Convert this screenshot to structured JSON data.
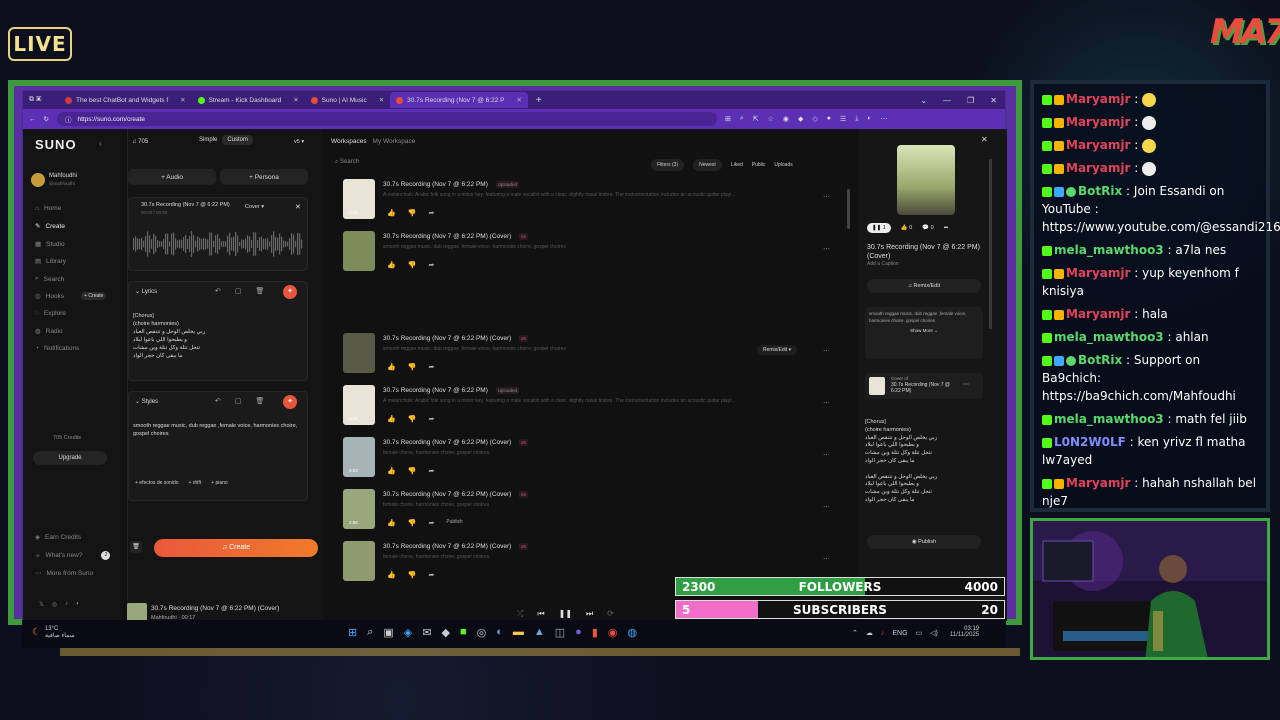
{
  "overlay": {
    "live": "LIVE",
    "logo": "MA7"
  },
  "browser": {
    "tabs": [
      {
        "label": "The best ChatBot and Widgets f",
        "color": "#d23c3c"
      },
      {
        "label": "Stream - Kick Dashboard",
        "color": "#53fc18"
      },
      {
        "label": "Suno | AI Music",
        "color": "#e74c3c"
      },
      {
        "label": "30.7s Recording (Nov 7 @ 6:22 P",
        "color": "#e74c3c"
      }
    ],
    "new_tab": "+",
    "url": "https://suno.com/create"
  },
  "suno": {
    "logo": "SUNO",
    "user": {
      "name": "Mahfoudhi",
      "handle": "@mahfoudhi"
    },
    "nav": [
      "Home",
      "Create",
      "Studio",
      "Library",
      "Search",
      "Hooks",
      "Explore",
      "Radio",
      "Notifications"
    ],
    "hooks_create": "+ Create",
    "credits": "705 Credits",
    "upgrade": "Upgrade",
    "footer": [
      "Earn Credits",
      "What's new?",
      "More from Suno"
    ],
    "whats_new_badge": "2",
    "create": {
      "credits": "705",
      "mode_simple": "Simple",
      "mode_custom": "Custom",
      "version": "v5",
      "audio": "+ Audio",
      "persona": "+ Persona",
      "clip_title": "30.7s Recording (Nov 7 @ 6:22 PM)",
      "clip_time": "00:00 / 00:30",
      "clip_mode": "Cover",
      "lyrics_label": "Lyrics",
      "lyrics": [
        "[Chorus]",
        "(choire harmonies)",
        "ربي يخلص الوحل و تتنقص العباد",
        "و يطيحوا اللي باعوا لبلاد",
        "تتحل تتلة وكل تتلة وين مشات",
        "ما يبقى كان حجر الواد"
      ],
      "styles_label": "Styles",
      "styles": "smooth reggae music, dub reggae ,female voice, harmonies choire, gospel choires",
      "style_tags": [
        "+ efectos de sonido",
        "+ drift",
        "+ piano"
      ],
      "create_btn": "Create"
    },
    "workspace": {
      "crumb1": "Workspaces",
      "crumb2": "My Workspace",
      "search": "Search",
      "filters": "Filters (3)",
      "newest": "Newest",
      "liked": "Liked",
      "public": "Public",
      "uploads": "Uploads",
      "rows": [
        {
          "title": "30.7s Recording (Nov 7 @ 6:22 PM)",
          "tag": "Uploaded",
          "desc": "A melancholic Arabic folk song in a minor key, featuring a male vocalist with a clear, slightly nasal timbre. The instrumentation includes an acoustic guitar playi...",
          "dur": "0:30",
          "thumb": "#e8e4d8"
        },
        {
          "title": "30.7s Recording (Nov 7 @ 6:22 PM) (Cover)",
          "tag": "v5",
          "desc": "smooth reggae music, dub reggae ,female voice, harmonies choire, gospel choires",
          "dur": "",
          "thumb": "#7d8a5a"
        },
        {
          "title": "30.7s Recording (Nov 7 @ 6:22 PM) (Cover)",
          "tag": "v5",
          "desc": "smooth reggae music, dub reggae ,female voice, harmonies choire, gospel choires",
          "dur": "",
          "thumb": "#5a5a48",
          "remix": "Remix/Edit"
        },
        {
          "title": "30.7s Recording (Nov 7 @ 6:22 PM)",
          "tag": "Uploaded",
          "desc": "A melancholic Arabic folk song in a minor key, featuring a male vocalist with a clear, slightly nasal timbre. The instrumentation includes an acoustic guitar playi...",
          "dur": "0:30",
          "thumb": "#e8e4d8"
        },
        {
          "title": "30.7s Recording (Nov 7 @ 6:22 PM) (Cover)",
          "tag": "v5",
          "desc": "female choire, harmonies choire, gospel choires",
          "dur": "3:03",
          "thumb": "#a6b4b8"
        },
        {
          "title": "30.7s Recording (Nov 7 @ 6:22 PM) (Cover)",
          "tag": "v5",
          "desc": "female choire, harmonies choire, gospel choires",
          "dur": "2:56",
          "thumb": "#9aa77c",
          "publish": "Publish"
        },
        {
          "title": "30.7s Recording (Nov 7 @ 6:22 PM) (Cover)",
          "tag": "v5",
          "desc": "female choire, harmonies choire, gospel choires",
          "dur": "",
          "thumb": "#8f9a70"
        }
      ]
    },
    "detail": {
      "likes": "0",
      "comments": "0",
      "plays": "1",
      "title": "30.7s Recording (Nov 7 @ 6:22 PM) (Cover)",
      "caption": "Add a Caption",
      "remix": "Remix/Edit",
      "styles": "smooth reggae music, dub reggae ,female voice, harmonies choire, gospel choires",
      "show_more": "Show More",
      "cover_of_label": "Cover of",
      "cover_of_title": "30.7s Recording (Nov 7 @ 6:22 PM)",
      "lyrics": [
        "[Chorus]",
        "(choire harmonies)",
        "ربي يخلص الوحل و تتنقص العباد",
        "و يطيحوا اللي باعوا لبلاد",
        "تتحل تتلة وكل تتلة وين مشات",
        "ما يبقى كان حجر الواد",
        "",
        "ربي يخلص الوحل و تتنقص العباد",
        "و يطيحوا اللي باعوا لبلاد",
        "تتحل تتلة وكل تتلة وين مشات",
        "ما يبقى كان حجر الواد"
      ],
      "publish": "Publish"
    },
    "player": {
      "title": "30.7s Recording (Nov 7 @ 6:22 PM) (Cover)",
      "artist": "Mahfoudhi",
      "time": "00:17",
      "progress": 0.55
    }
  },
  "taskbar": {
    "weather_temp": "13°C",
    "weather_desc": "سماء صافية",
    "lang": "ENG",
    "time": "03:19",
    "date": "11/11/2025"
  },
  "goals": {
    "followers": {
      "label": "FOLLOWERS",
      "current": "2300",
      "target": "4000",
      "fraction": 0.575,
      "color": "#2f9e44"
    },
    "subscribers": {
      "label": "SUBSCRIBERS",
      "current": "5",
      "target": "20",
      "fraction": 0.25,
      "color": "#f06ec8"
    }
  },
  "chat": [
    {
      "user": "Maryamjr",
      "color": "#e0445a",
      "text": "",
      "emote": "#f5d64a",
      "verified": false,
      "badge": "#f5b400"
    },
    {
      "user": "Maryamjr",
      "color": "#e0445a",
      "text": "",
      "emote": "#eeeeee",
      "verified": false,
      "badge": "#f5b400"
    },
    {
      "user": "Maryamjr",
      "color": "#e0445a",
      "text": "",
      "emote": "#f5d64a",
      "verified": false,
      "badge": "#f5b400"
    },
    {
      "user": "Maryamjr",
      "color": "#e0445a",
      "text": "",
      "emote": "#eeeeee",
      "verified": false,
      "badge": "#f5b400"
    },
    {
      "user": "BotRix",
      "color": "#5bd86c",
      "text": "Join Essandi on YouTube : https://www.youtube.com/@essandi216",
      "verified": true,
      "badge": "#3fa8ff"
    },
    {
      "user": "mela_mawthoo3",
      "color": "#5bd86c",
      "text": "a7la nes",
      "verified": false,
      "badge": ""
    },
    {
      "user": "Maryamjr",
      "color": "#e0445a",
      "text": "yup keyenhom f knisiya",
      "verified": false,
      "badge": "#f5b400"
    },
    {
      "user": "Maryamjr",
      "color": "#e0445a",
      "text": "hala",
      "verified": false,
      "badge": "#f5b400"
    },
    {
      "user": "mela_mawthoo3",
      "color": "#5bd86c",
      "text": "ahlan",
      "verified": false,
      "badge": ""
    },
    {
      "user": "BotRix",
      "color": "#5bd86c",
      "text": "Support on Ba9chich: https://ba9chich.com/Mahfoudhi",
      "verified": true,
      "badge": "#3fa8ff"
    },
    {
      "user": "mela_mawthoo3",
      "color": "#5bd86c",
      "text": "math fel jiib",
      "verified": false,
      "badge": ""
    },
    {
      "user": "L0N2W0LF",
      "color": "#7f8cff",
      "text": "ken yrivz fl matha lw7ayed",
      "verified": false,
      "badge": ""
    },
    {
      "user": "Maryamjr",
      "color": "#e0445a",
      "text": "hahah nshallah bel nje7",
      "verified": false,
      "badge": "#f5b400"
    }
  ]
}
